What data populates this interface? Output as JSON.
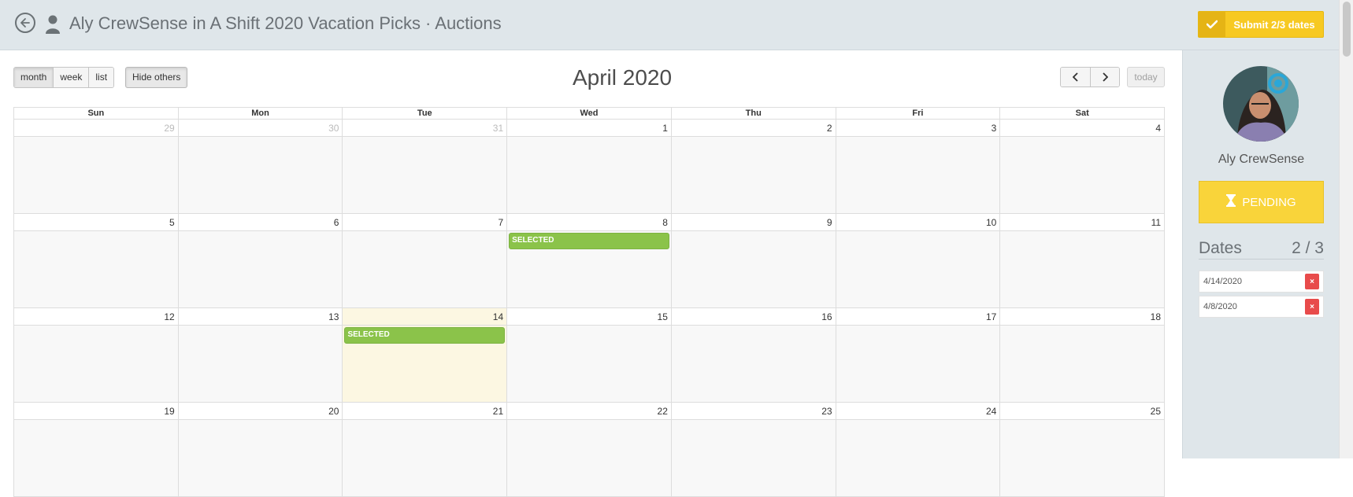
{
  "header": {
    "title": "Aly CrewSense in A Shift 2020 Vacation Picks · Auctions",
    "submit_label": "Submit 2/3 dates",
    "back_icon": "arrow-left-circle-icon",
    "user_icon": "user-icon",
    "accent_color": "#f7c922"
  },
  "toolbar": {
    "views": [
      "month",
      "week",
      "list"
    ],
    "active_view": "month",
    "hide_others_label": "Hide others",
    "today_label": "today"
  },
  "calendar": {
    "title": "April 2020",
    "weekdays": [
      "Sun",
      "Mon",
      "Tue",
      "Wed",
      "Thu",
      "Fri",
      "Sat"
    ],
    "weeks": [
      [
        {
          "n": "29",
          "other": true
        },
        {
          "n": "30",
          "other": true
        },
        {
          "n": "31",
          "other": true
        },
        {
          "n": "1"
        },
        {
          "n": "2"
        },
        {
          "n": "3"
        },
        {
          "n": "4"
        }
      ],
      [
        {
          "n": "5"
        },
        {
          "n": "6"
        },
        {
          "n": "7"
        },
        {
          "n": "8",
          "event": "SELECTED"
        },
        {
          "n": "9"
        },
        {
          "n": "10"
        },
        {
          "n": "11"
        }
      ],
      [
        {
          "n": "12"
        },
        {
          "n": "13"
        },
        {
          "n": "14",
          "today": true,
          "event": "SELECTED"
        },
        {
          "n": "15"
        },
        {
          "n": "16"
        },
        {
          "n": "17"
        },
        {
          "n": "18"
        }
      ],
      [
        {
          "n": "19"
        },
        {
          "n": "20"
        },
        {
          "n": "21"
        },
        {
          "n": "22"
        },
        {
          "n": "23"
        },
        {
          "n": "24"
        },
        {
          "n": "25"
        }
      ]
    ],
    "event_color": "#8bc34a",
    "today_color": "#fcf7e2"
  },
  "sidebar": {
    "user_name": "Aly CrewSense",
    "status_label": "PENDING",
    "status_icon": "hourglass-icon",
    "dates_label": "Dates",
    "dates_count": "2 / 3",
    "dates": [
      "4/14/2020",
      "4/8/2020"
    ],
    "remove_label": "×"
  }
}
